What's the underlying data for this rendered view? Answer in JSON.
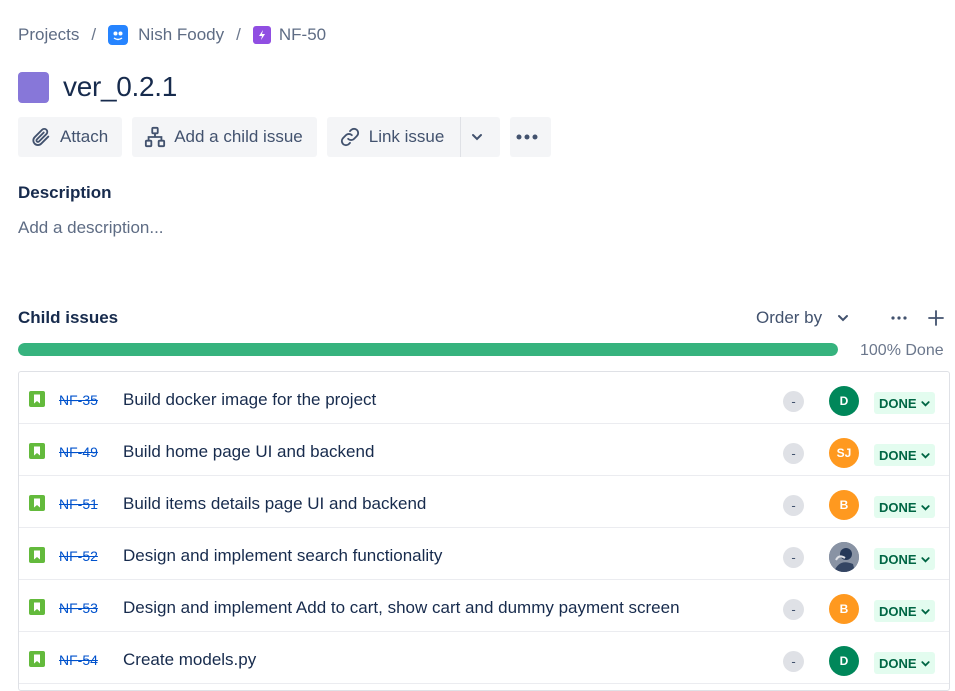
{
  "breadcrumb": {
    "root": "Projects",
    "separator": "/",
    "project": "Nish Foody",
    "epic_key": "NF-50"
  },
  "issue": {
    "title": "ver_0.2.1",
    "color": "#8777d9"
  },
  "toolbar": {
    "attach": "Attach",
    "add_child": "Add a child issue",
    "link_issue": "Link issue"
  },
  "description": {
    "label": "Description",
    "placeholder": "Add a description..."
  },
  "child_issues": {
    "label": "Child issues",
    "order_by": "Order by",
    "progress_percent": 100,
    "progress_label": "100% Done",
    "progress_color": "#36b37e",
    "items": [
      {
        "key": "NF-35",
        "summary": "Build docker image for the project",
        "priority": "-",
        "assignee_initials": "D",
        "assignee_color": "#00875a",
        "status": "DONE"
      },
      {
        "key": "NF-49",
        "summary": "Build home page UI and backend",
        "priority": "-",
        "assignee_initials": "SJ",
        "assignee_color": "#ff991f",
        "status": "DONE"
      },
      {
        "key": "NF-51",
        "summary": "Build items details page UI and backend",
        "priority": "-",
        "assignee_initials": "B",
        "assignee_color": "#ff991f",
        "status": "DONE"
      },
      {
        "key": "NF-52",
        "summary": "Design and implement search functionality",
        "priority": "-",
        "assignee_initials": "",
        "assignee_color": "#6b778c",
        "status": "DONE"
      },
      {
        "key": "NF-53",
        "summary": "Design and implement Add to cart, show cart and dummy payment screen",
        "priority": "-",
        "assignee_initials": "B",
        "assignee_color": "#ff991f",
        "status": "DONE"
      },
      {
        "key": "NF-54",
        "summary": "Create models.py",
        "priority": "-",
        "assignee_initials": "D",
        "assignee_color": "#00875a",
        "status": "DONE"
      }
    ]
  }
}
